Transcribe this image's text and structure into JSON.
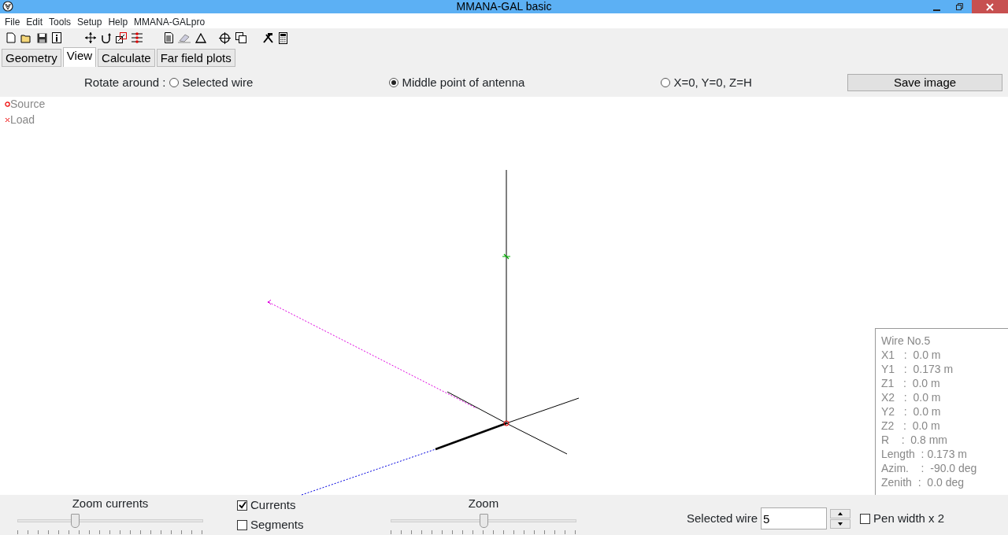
{
  "window": {
    "title": "MMANA-GAL basic"
  },
  "menu": [
    "File",
    "Edit",
    "Tools",
    "Setup",
    "Help",
    "MMANA-GALpro"
  ],
  "tabs": [
    {
      "label": "Geometry",
      "selected": false
    },
    {
      "label": "View",
      "selected": true
    },
    {
      "label": "Calculate",
      "selected": false
    },
    {
      "label": "Far field plots",
      "selected": false
    }
  ],
  "rotate_around": {
    "label": "Rotate around :",
    "options": [
      {
        "label": "Selected wire",
        "selected": false
      },
      {
        "label": "Middle point of antenna",
        "selected": true
      },
      {
        "label": "X=0, Y=0, Z=H",
        "selected": false
      }
    ]
  },
  "save_button": "Save image",
  "legend": [
    {
      "kind": "source",
      "label": "Source"
    },
    {
      "kind": "load",
      "label": "Load"
    }
  ],
  "wire_info": [
    "Wire No.5",
    "X1   :  0.0 m",
    "Y1   :  0.173 m",
    "Z1   :  0.0 m",
    "X2   :  0.0 m",
    "Y2   :  0.0 m",
    "Z2   :  0.0 m",
    "R    :  0.8 mm",
    "Length  : 0.173 m",
    "Azim.    :  -90.0 deg",
    "Zenith  :  0.0 deg"
  ],
  "zoom_currents": {
    "label": "Zoom currents",
    "level": 0.31
  },
  "options": [
    {
      "label": "Currents",
      "checked": true
    },
    {
      "label": "Segments",
      "checked": false
    }
  ],
  "zoom": {
    "label": "Zoom",
    "level": 0.5
  },
  "selected_wire": {
    "label": "Selected wire",
    "value": "5"
  },
  "pen_width": {
    "label": "Pen width x 2",
    "checked": false
  }
}
